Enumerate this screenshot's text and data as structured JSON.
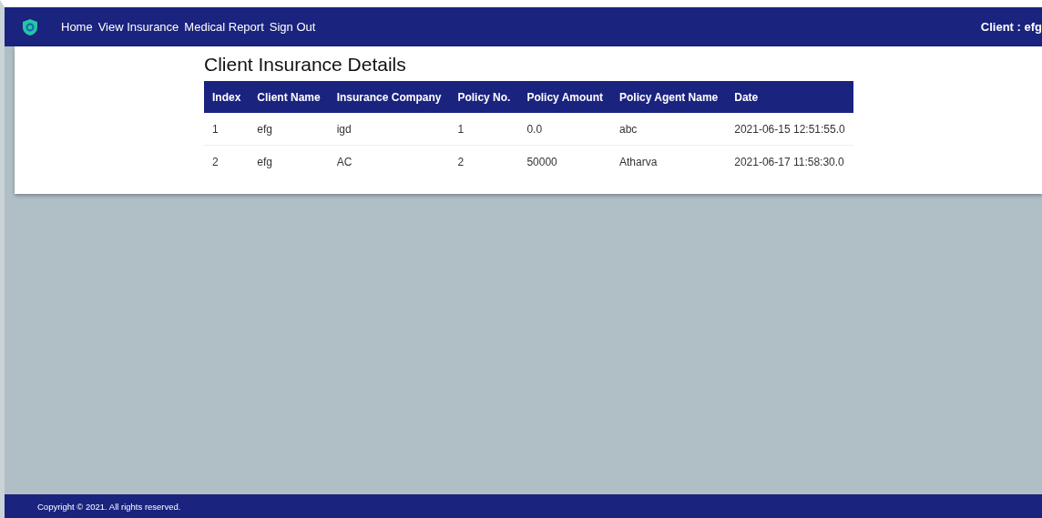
{
  "navbar": {
    "links": [
      "Home",
      "View Insurance",
      "Medical Report",
      "Sign Out"
    ],
    "user": "Client : efg"
  },
  "page": {
    "title": "Client Insurance Details"
  },
  "table": {
    "columns": [
      "Index",
      "Client Name",
      "Insurance Company",
      "Policy No.",
      "Policy Amount",
      "Policy Agent Name",
      "Date"
    ],
    "rows": [
      [
        "1",
        "efg",
        "igd",
        "1",
        "0.0",
        "abc",
        "2021-06-15 12:51:55.0"
      ],
      [
        "2",
        "efg",
        "AC",
        "2",
        "50000",
        "Atharva",
        "2021-06-17 11:58:30.0"
      ]
    ]
  },
  "footer": {
    "text": "Copyright © 2021. All rights reserved."
  }
}
